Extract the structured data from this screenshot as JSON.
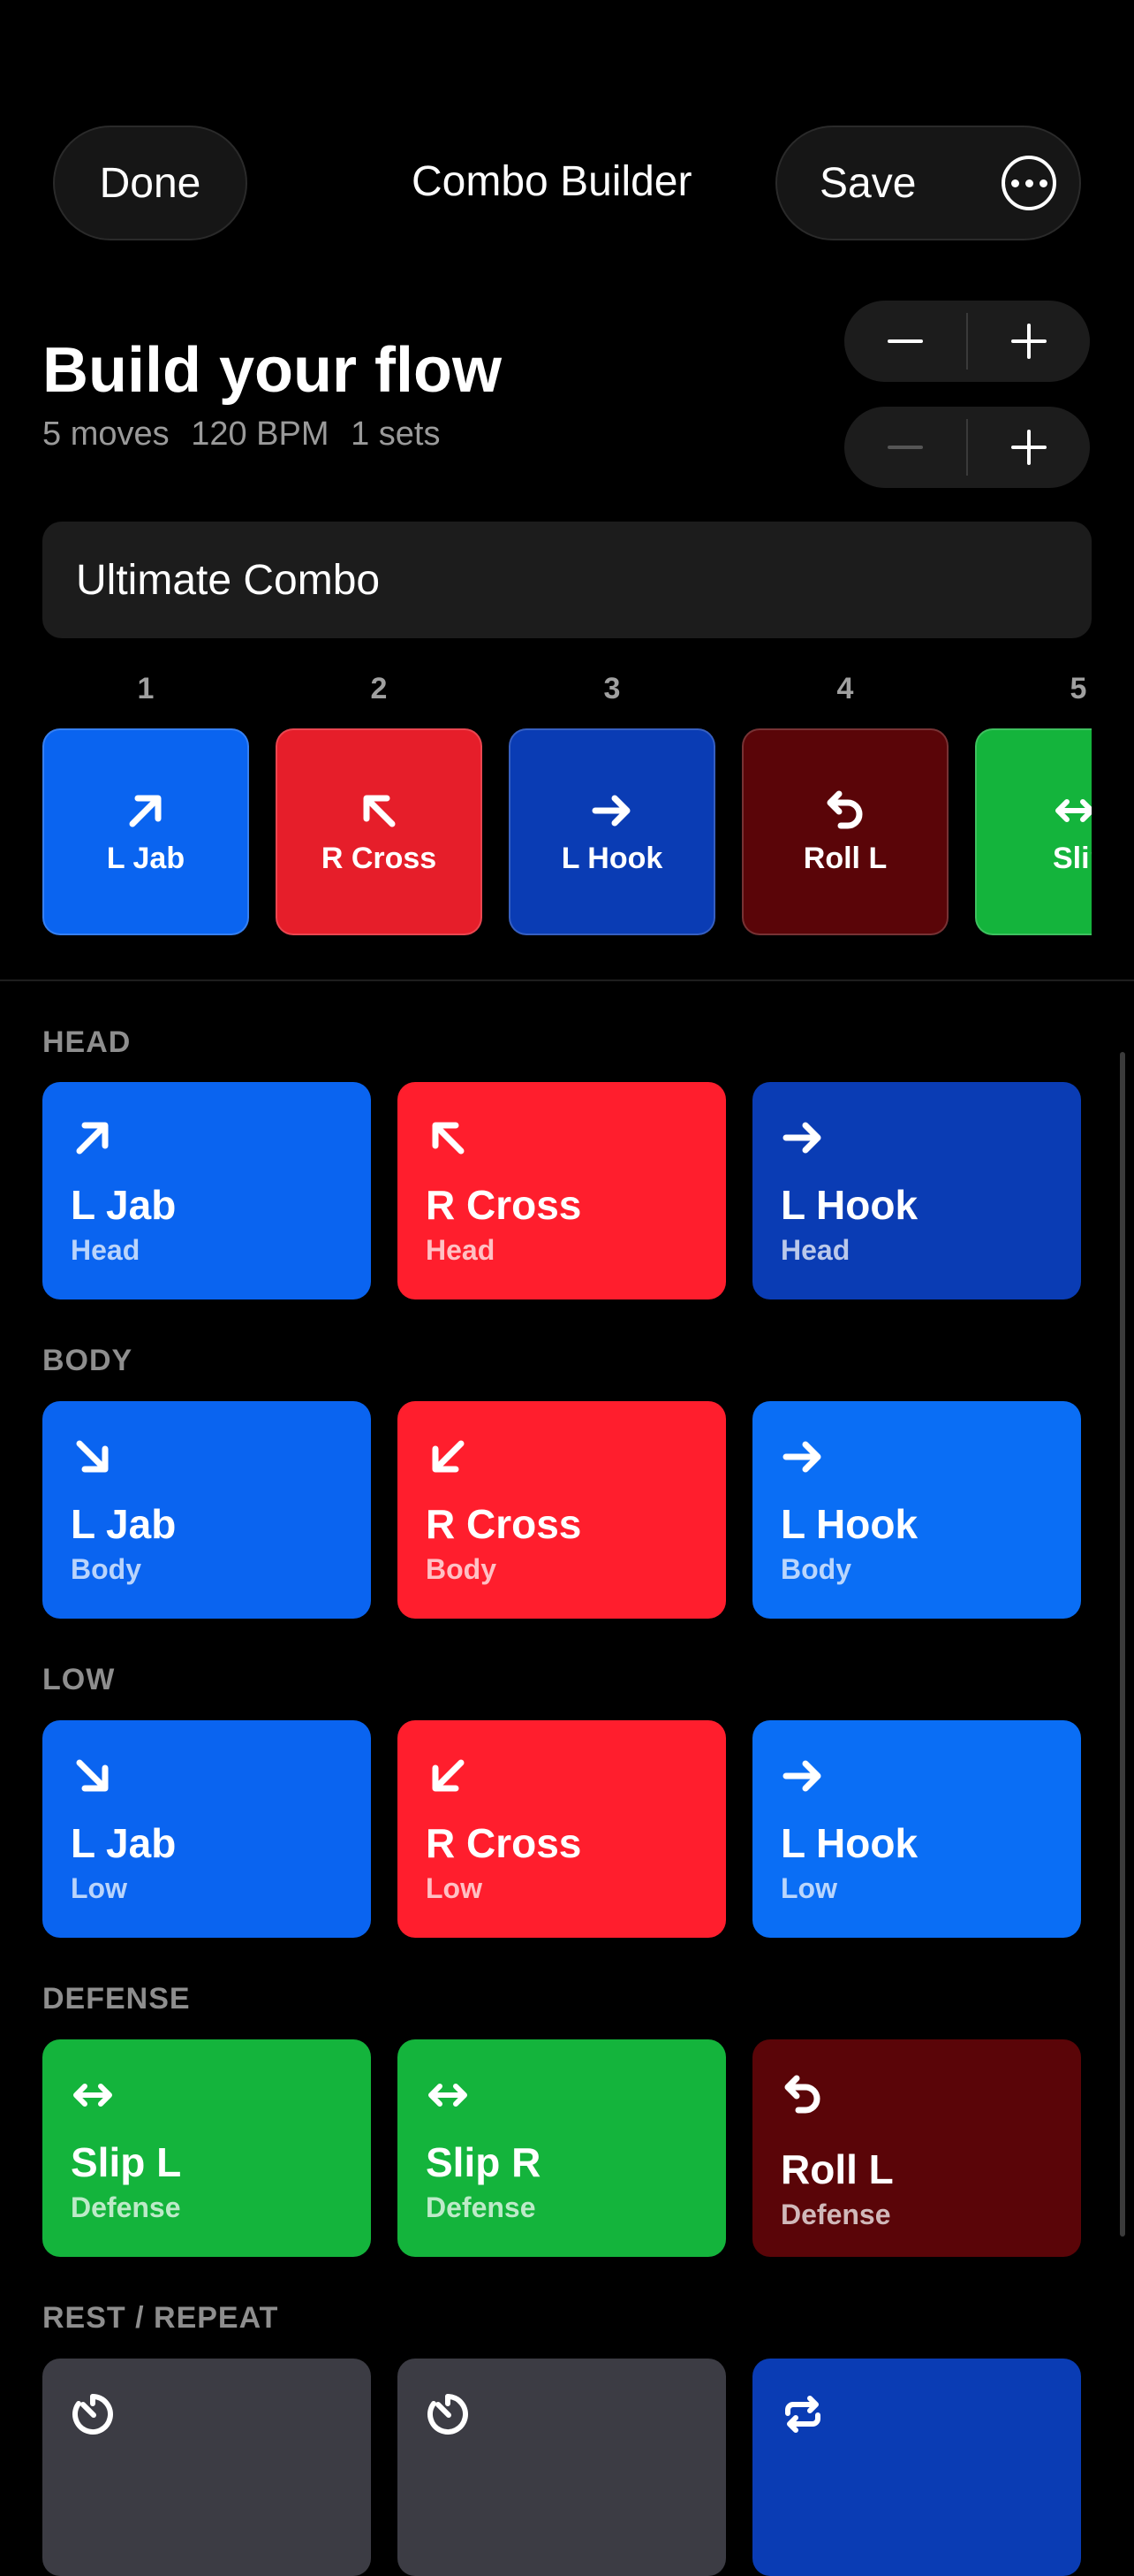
{
  "header": {
    "done_label": "Done",
    "title": "Combo Builder",
    "save_label": "Save",
    "more_icon": "ellipsis-circle-icon"
  },
  "summary": {
    "heading": "Build your flow",
    "moves": "5 moves",
    "bpm": "120 BPM",
    "sets": "1 sets"
  },
  "steppers": [
    {
      "minus": "minus-icon",
      "plus": "plus-icon",
      "minus_enabled": true
    },
    {
      "minus": "minus-icon",
      "plus": "plus-icon",
      "minus_enabled": false
    }
  ],
  "combo_name": {
    "value": "Ultimate Combo"
  },
  "sequence": [
    {
      "num": "1",
      "label": "L Jab",
      "icon": "arrow-up-right-icon",
      "color": "#0a64f0"
    },
    {
      "num": "2",
      "label": "R Cross",
      "icon": "arrow-up-left-icon",
      "color": "#e61e2a"
    },
    {
      "num": "3",
      "label": "L Hook",
      "icon": "arrow-right-icon",
      "color": "#0a3cb4"
    },
    {
      "num": "4",
      "label": "Roll L",
      "icon": "undo-arrow-icon",
      "color": "#5a0508"
    },
    {
      "num": "5",
      "label": "Slip",
      "icon": "arrow-left-right-icon",
      "color": "#14b43c"
    }
  ],
  "palette": {
    "head": {
      "title": "HEAD",
      "items": [
        {
          "name": "L Jab",
          "sub": "Head",
          "icon": "arrow-up-right-icon",
          "color": "#0a64f0"
        },
        {
          "name": "R Cross",
          "sub": "Head",
          "icon": "arrow-up-left-icon",
          "color": "#ff1e2d"
        },
        {
          "name": "L Hook",
          "sub": "Head",
          "icon": "arrow-right-icon",
          "color": "#0a3cb4"
        }
      ]
    },
    "body": {
      "title": "BODY",
      "items": [
        {
          "name": "L Jab",
          "sub": "Body",
          "icon": "arrow-down-right-icon",
          "color": "#0a64f0"
        },
        {
          "name": "R Cross",
          "sub": "Body",
          "icon": "arrow-down-left-icon",
          "color": "#ff1e2d"
        },
        {
          "name": "L Hook",
          "sub": "Body",
          "icon": "arrow-right-icon",
          "color": "#0a6ef5"
        }
      ]
    },
    "low": {
      "title": "LOW",
      "items": [
        {
          "name": "L Jab",
          "sub": "Low",
          "icon": "arrow-down-right-icon",
          "color": "#0a64f0"
        },
        {
          "name": "R Cross",
          "sub": "Low",
          "icon": "arrow-down-left-icon",
          "color": "#ff1e2d"
        },
        {
          "name": "L Hook",
          "sub": "Low",
          "icon": "arrow-right-icon",
          "color": "#0a6ef5"
        }
      ]
    },
    "defense": {
      "title": "DEFENSE",
      "items": [
        {
          "name": "Slip L",
          "sub": "Defense",
          "icon": "arrow-left-right-icon",
          "color": "#14b43c"
        },
        {
          "name": "Slip R",
          "sub": "Defense",
          "icon": "arrow-left-right-icon",
          "color": "#14b43c"
        },
        {
          "name": "Roll L",
          "sub": "Defense",
          "icon": "undo-arrow-icon",
          "color": "#5a0508"
        }
      ]
    },
    "rest": {
      "title": "REST / REPEAT",
      "items": [
        {
          "icon": "timer-icon",
          "color": "#3c3c44"
        },
        {
          "icon": "timer-icon",
          "color": "#3c3c44"
        },
        {
          "icon": "repeat-icon",
          "color": "#0a3cb4"
        }
      ]
    }
  }
}
